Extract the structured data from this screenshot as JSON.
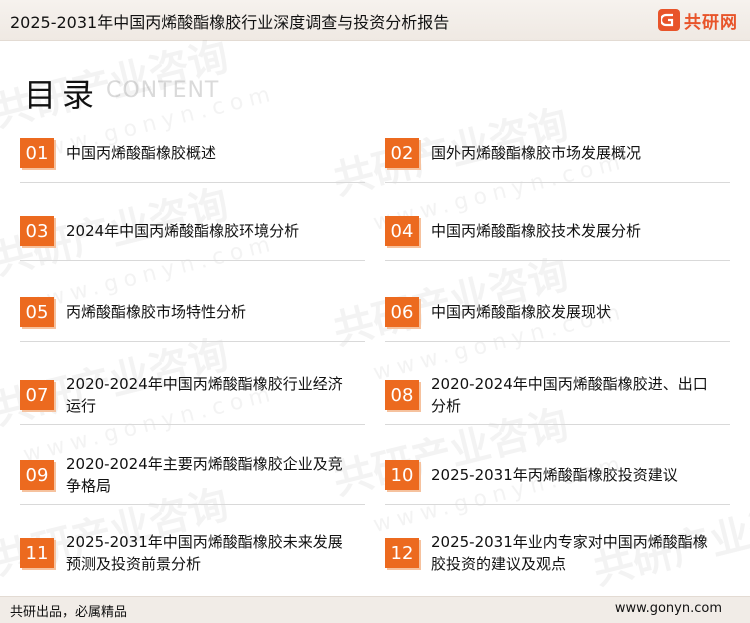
{
  "header": {
    "title": "2025-2031年中国丙烯酸酯橡胶行业深度调查与投资分析报告",
    "logo_text": "共研网"
  },
  "watermark": {
    "brand": "共研产业咨询",
    "url": "www.gonyn.com"
  },
  "toc": {
    "heading": "目录",
    "heading_en": "CONTENT",
    "items": [
      {
        "num": "01",
        "label": "中国丙烯酸酯橡胶概述"
      },
      {
        "num": "02",
        "label": "国外丙烯酸酯橡胶市场发展概况"
      },
      {
        "num": "03",
        "label": "2024年中国丙烯酸酯橡胶环境分析"
      },
      {
        "num": "04",
        "label": "中国丙烯酸酯橡胶技术发展分析"
      },
      {
        "num": "05",
        "label": "丙烯酸酯橡胶市场特性分析"
      },
      {
        "num": "06",
        "label": "中国丙烯酸酯橡胶发展现状"
      },
      {
        "num": "07",
        "label": "2020-2024年中国丙烯酸酯橡胶行业经济运行"
      },
      {
        "num": "08",
        "label": "2020-2024年中国丙烯酸酯橡胶进、出口分析"
      },
      {
        "num": "09",
        "label": "2020-2024年主要丙烯酸酯橡胶企业及竞争格局"
      },
      {
        "num": "10",
        "label": "2025-2031年丙烯酸酯橡胶投资建议"
      },
      {
        "num": "11",
        "label": "2025-2031年中国丙烯酸酯橡胶未来发展预测及投资前景分析"
      },
      {
        "num": "12",
        "label": "2025-2031年业内专家对中国丙烯酸酯橡胶投资的建议及观点"
      }
    ]
  },
  "footer": {
    "slogan": "共研出品，必属精品",
    "website": "www.gonyn.com"
  },
  "colors": {
    "accent": "#ec6a1f",
    "logo": "#e8542a"
  }
}
